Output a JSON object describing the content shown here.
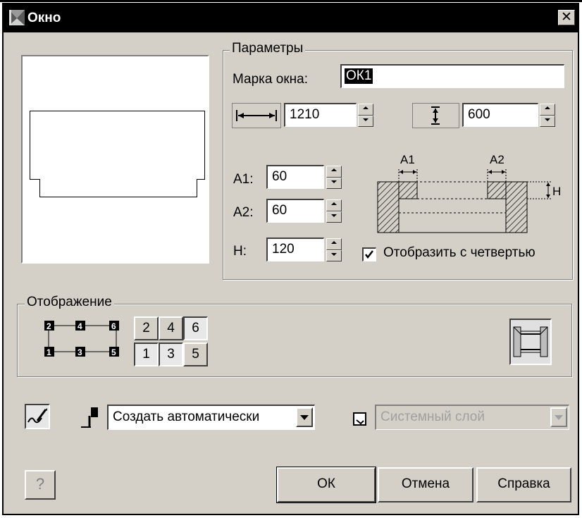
{
  "window": {
    "title": "Окно"
  },
  "parameters": {
    "group_label": "Параметры",
    "mark_label": "Марка окна:",
    "mark_value": "ОК1",
    "width_value": "1210",
    "height_value": "600",
    "a1_label": "A1:",
    "a1_value": "60",
    "a2_label": "A2:",
    "a2_value": "60",
    "h_label": "H:",
    "h_value": "120",
    "diagram_a1": "A1",
    "diagram_a2": "A2",
    "diagram_h": "H",
    "show_quarter_label": "Отобразить с четвертью",
    "show_quarter_checked": true
  },
  "display": {
    "group_label": "Отображение",
    "legend_top": [
      "2",
      "4",
      "6"
    ],
    "legend_bottom": [
      "1",
      "3",
      "5"
    ],
    "grid_top": [
      "2",
      "4",
      "6"
    ],
    "grid_bottom": [
      "1",
      "3",
      "5"
    ],
    "selected_cells": [
      "6",
      "1",
      "3"
    ]
  },
  "layer_row": {
    "layer_create_value": "Создать автоматически",
    "system_layer_value": "Системный слой"
  },
  "buttons": {
    "help_icon_label": "?",
    "ok": "ОК",
    "cancel": "Отмена",
    "help": "Справка"
  },
  "icons": {
    "title": "window-app-icon",
    "close": "close-icon",
    "width": "horizontal-arrows-icon",
    "height": "vertical-arrows-icon",
    "pen": "pen-edit-icon",
    "brush": "brush-icon",
    "layer": "layer-icon",
    "frame": "window-frame-icon"
  }
}
